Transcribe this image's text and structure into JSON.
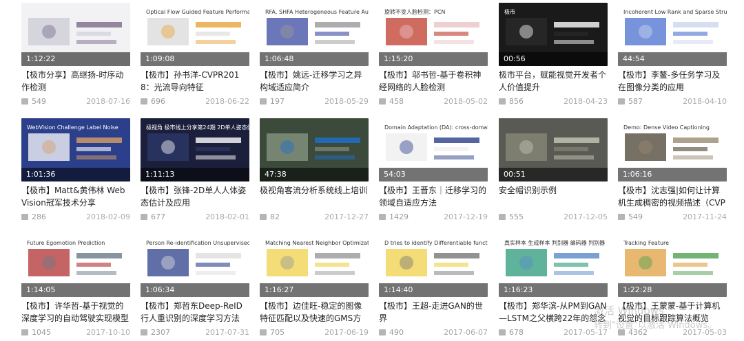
{
  "videos": [
    {
      "duration": "1:12:22",
      "title": "【极市分享】高继扬-时序动作检测",
      "views": "549",
      "date": "2018-07-16",
      "colors": [
        "#f2f2f4",
        "#c9cbd6",
        "#7c6a8a"
      ],
      "text": ""
    },
    {
      "duration": "1:09:08",
      "title": "【极市】孙书洋-CVPR2018：光流导向特征",
      "views": "696",
      "date": "2018-06-22",
      "colors": [
        "#ffffff",
        "#d9d9d9",
        "#e8a43a"
      ],
      "text": "Optical Flow Guided Feature Performance"
    },
    {
      "duration": "1:06:48",
      "title": "【极市】姚远-迁移学习之异构域适应简介",
      "views": "197",
      "date": "2018-05-29",
      "colors": [
        "#ffffff",
        "#3a4aa0",
        "#999999"
      ],
      "text": "RFA, SHFA Heterogeneous Feature Augmentation Type: symmetric transformation Feature augmentation: Objective function:"
    },
    {
      "duration": "1:15:20",
      "title": "【极市】邬书哲-基于卷积神经网络的人脸检测",
      "views": "458",
      "date": "2018-05-02",
      "colors": [
        "#ffffff",
        "#c0392b",
        "#e8c6c6"
      ],
      "text": "旋转不变人脸检测：PCN"
    },
    {
      "duration": "00:56",
      "title": "极市平台，赋能视觉开发者个人价值提升",
      "views": "856",
      "date": "2018-04-23",
      "colors": [
        "#1a1a1a",
        "#2b2b2b",
        "#ffffff"
      ],
      "text": "极市"
    },
    {
      "duration": "44:54",
      "title": "【极市】李鳌-多任务学习及在图像分类的应用",
      "views": "587",
      "date": "2018-04-10",
      "colors": [
        "#ffffff",
        "#4a6fd0",
        "#ccd6ee"
      ],
      "text": "Incoherent Low Rank and Sparse Structure"
    },
    {
      "duration": "1:01:36",
      "title": "【极市】Matt&黄伟林 WebVision冠军技术分享",
      "views": "286",
      "date": "2018-02-09",
      "colors": [
        "#2b3f8a",
        "#ffffff",
        "#d9a066"
      ],
      "text": "WebVision Challenge Label Noise"
    },
    {
      "duration": "1:11:13",
      "title": "【极市】张锋-2D单人人体姿态估计及应用",
      "views": "677",
      "date": "2018-02-01",
      "colors": [
        "#1b1f3b",
        "#2e3a6b",
        "#ffffff"
      ],
      "text": "极视角 极市线上分享第24期 2D单人姿态估计及应用 张锋"
    },
    {
      "duration": "47:38",
      "title": "极视角客流分析系统线上培训",
      "views": "82",
      "date": "2017-12-27",
      "colors": [
        "#3b4a3a",
        "#8a9a86",
        "#1f6fd0"
      ],
      "text": ""
    },
    {
      "duration": "54:03",
      "title": "【极市】王晋东｜迁移学习的领域自适应方法",
      "views": "1429",
      "date": "2017-12-19",
      "colors": [
        "#ffffff",
        "#ededed",
        "#2b3f8a"
      ],
      "text": "Domain Adaptation (DA): cross-domain learning"
    },
    {
      "duration": "00:51",
      "title": "安全帽识别示例",
      "views": "555",
      "date": "2017-12-05",
      "colors": [
        "#5a5a54",
        "#8a8a7a",
        "#c8c8b8"
      ],
      "text": ""
    },
    {
      "duration": "1:06:16",
      "title": "【极市】沈志强|如何让计算机生成稠密的视频描述（CVPR）",
      "views": "549",
      "date": "2017-11-24",
      "colors": [
        "#ffffff",
        "#4a4030",
        "#9a8a70"
      ],
      "text": "Demo: Dense Video Captioning"
    },
    {
      "duration": "1:14:05",
      "title": "【极市】许华哲-基于视觉的深度学习的自动驾驶实现模型",
      "views": "1045",
      "date": "2017-10-10",
      "colors": [
        "#ffffff",
        "#b03030",
        "#6a7a8a"
      ],
      "text": "Future Egomotion Prediction"
    },
    {
      "duration": "1:06:34",
      "title": "【极市】郑哲东Deep-ReID行人重识别的深度学习方法",
      "views": "2307",
      "date": "2017-07-31",
      "colors": [
        "#ffffff",
        "#2b3f8a",
        "#dddddd"
      ],
      "text": "Person Re-identification Unsupervised / Semi-supervised Learning"
    },
    {
      "duration": "1:16:27",
      "title": "【极市】边佳旺-稳定的图像特征匹配以及快速的GMS方案",
      "views": "705",
      "date": "2017-06-19",
      "colors": [
        "#ffffff",
        "#f0d048",
        "#999999"
      ],
      "text": "Matching Nearest Neighbor Optimization Others Brute Force Approximate(FLANN) Matching Algorithms Graph Matching"
    },
    {
      "duration": "1:14:40",
      "title": "【极市】王超-走进GAN的世界",
      "views": "490",
      "date": "2017-06-07",
      "colors": [
        "#ffffff",
        "#f0d048",
        "#777777"
      ],
      "text": "D tries to identify Differentiable function D a sample from data a sampled from model"
    },
    {
      "duration": "1:16:23",
      "title": "【极市】郑华滨-从PM到GAN—LSTM之父横跨22年的怨念",
      "views": "678",
      "date": "2017-05-17",
      "colors": [
        "#ffffff",
        "#2a9a7a",
        "#5a8ac8"
      ],
      "text": "真实样本 生成样本 判别器 编码器 判别器"
    },
    {
      "duration": "1:22:28",
      "title": "【极市】王蒙蒙-基于计算机视觉的目标跟踪算法概览",
      "views": "4362",
      "date": "2017-05-03",
      "colors": [
        "#ffffff",
        "#e0a040",
        "#50a050"
      ],
      "text": "Tracking Feature"
    }
  ],
  "watermark": {
    "line1": "激活 Windows",
    "line2": "转到\"设置\"以激活 Windows。"
  }
}
